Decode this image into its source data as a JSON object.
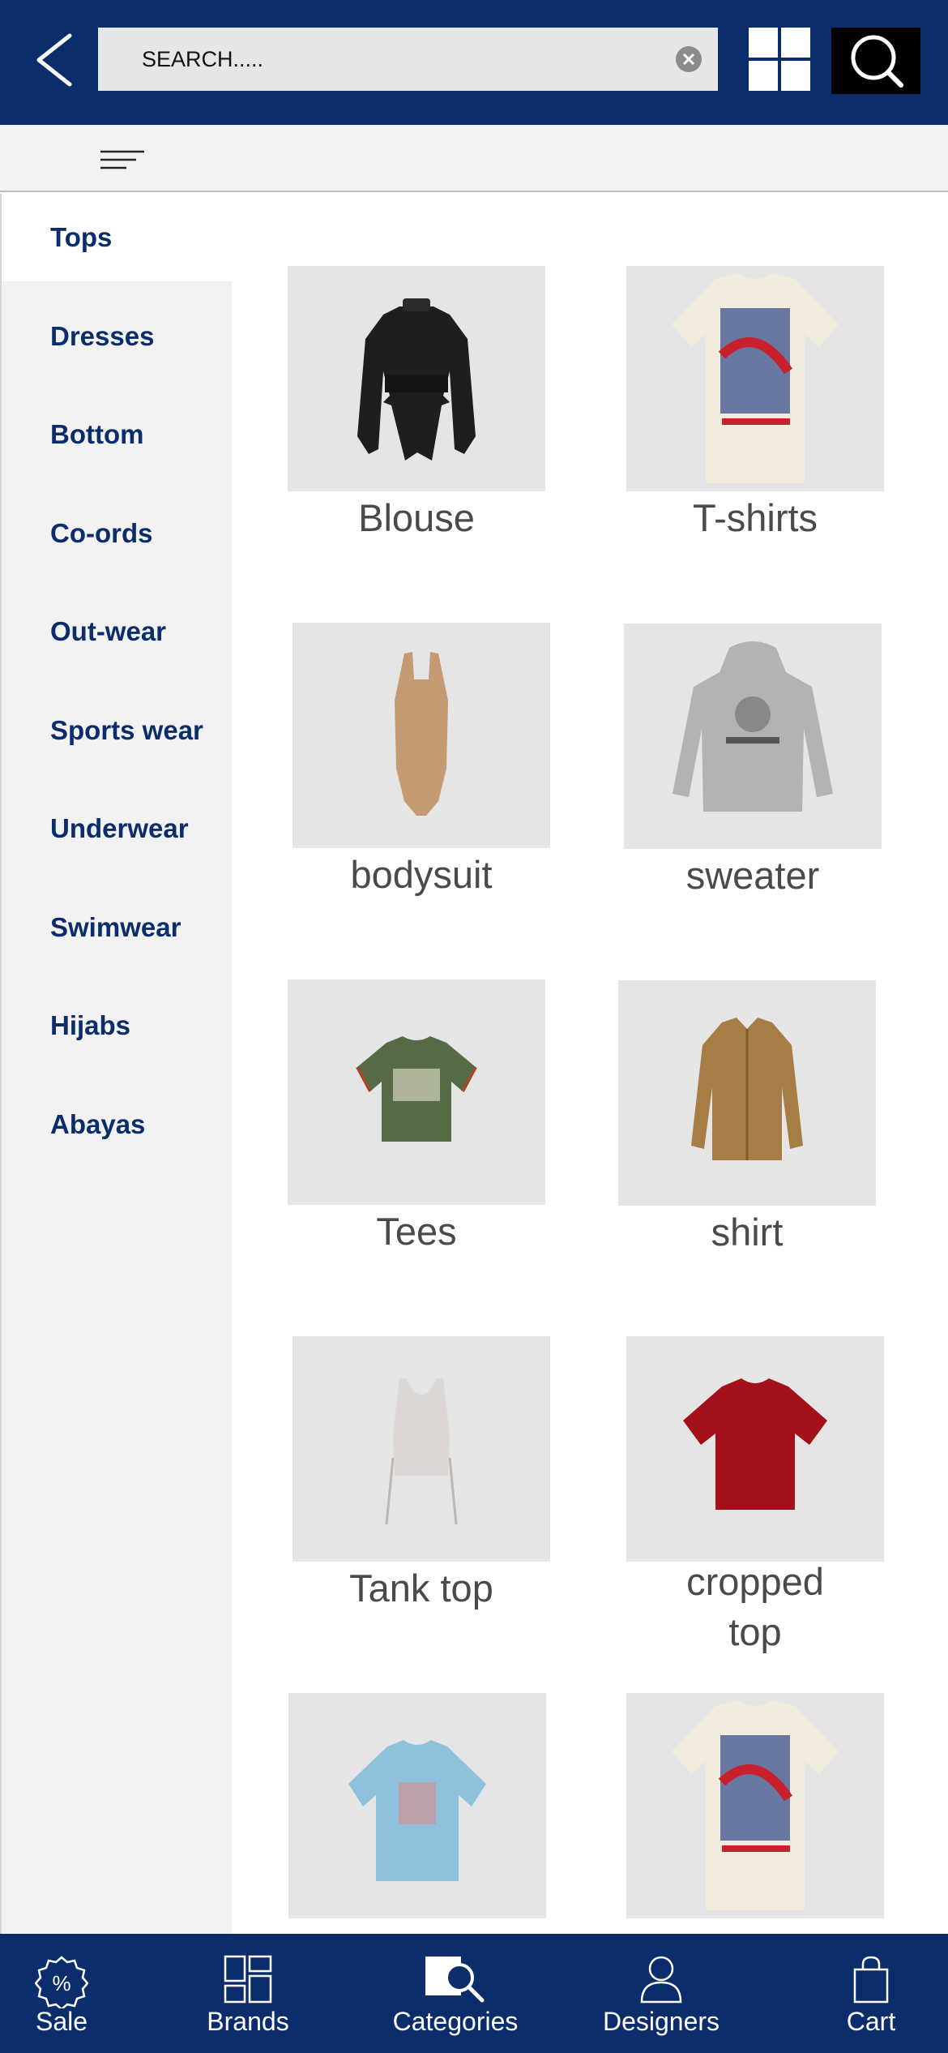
{
  "header": {
    "back_icon": "chevron-left-icon",
    "search_placeholder": "SEARCH.....",
    "clear_icon": "clear-circle-icon",
    "grid_icon": "grid-view-icon",
    "search_icon": "search-icon"
  },
  "filter": {
    "icon": "filter-lines-icon"
  },
  "sidebar": {
    "items": [
      {
        "label": "Tops",
        "active": true
      },
      {
        "label": "Dresses"
      },
      {
        "label": "Bottom"
      },
      {
        "label": "Co-ords"
      },
      {
        "label": "Out-wear"
      },
      {
        "label": "Sports wear"
      },
      {
        "label": "Underwear"
      },
      {
        "label": "Swimwear"
      },
      {
        "label": "Hijabs"
      },
      {
        "label": "Abayas"
      }
    ]
  },
  "products": [
    {
      "label": "Blouse",
      "image": "black satin blouse"
    },
    {
      "label": "T-shirts",
      "image": "cream printed t-shirt"
    },
    {
      "label": "bodysuit",
      "image": "tan bodysuit"
    },
    {
      "label": "sweater",
      "image": "grey hoodie sweater"
    },
    {
      "label": "Tees",
      "image": "green cropped tee"
    },
    {
      "label": "shirt",
      "image": "brown button shirt"
    },
    {
      "label": "Tank top",
      "image": "white ruched tank top"
    },
    {
      "label": "cropped top",
      "image": "red cropped top"
    },
    {
      "label": "",
      "image": "blue graphic tee"
    },
    {
      "label": "",
      "image": "cream printed t-shirt"
    }
  ],
  "bottom_nav": [
    {
      "label": "Sale",
      "icon": "percent-badge-icon"
    },
    {
      "label": "Brands",
      "icon": "brands-grid-icon"
    },
    {
      "label": "Categories",
      "icon": "categories-search-icon"
    },
    {
      "label": "Designers",
      "icon": "user-icon"
    },
    {
      "label": "Cart",
      "icon": "shopping-bag-icon"
    }
  ],
  "colors": {
    "primary": "#0c2d6b",
    "sidebar_bg": "#f2f2f2",
    "card_bg": "#e5e5e5",
    "label": "#4a4a4a"
  }
}
